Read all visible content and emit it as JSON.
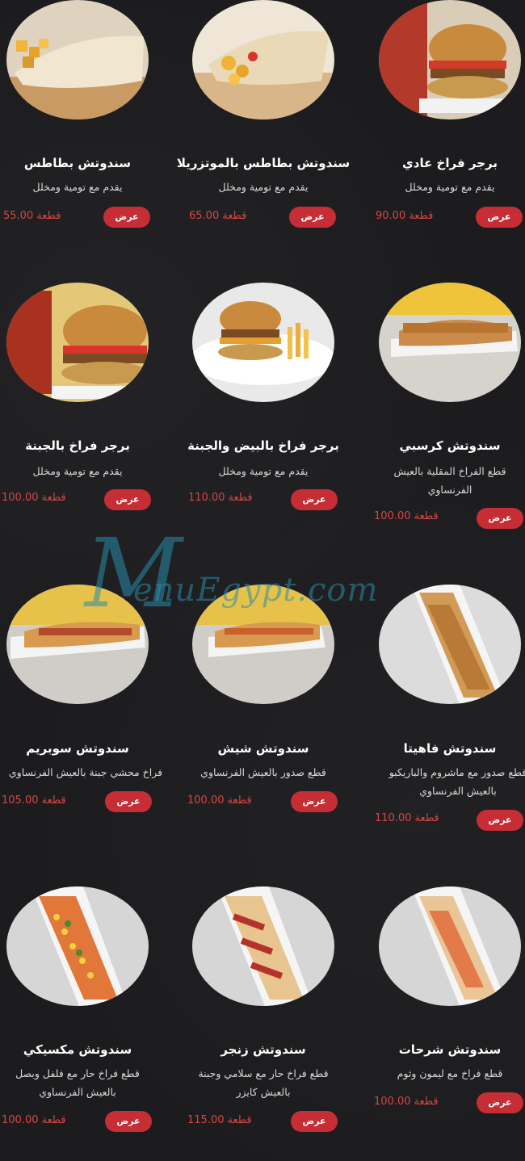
{
  "currency_unit": "قطعة",
  "button_label": "عرض",
  "watermark": {
    "initial": "M",
    "text": "enuEgypt.com"
  },
  "items": [
    {
      "name": "برجر فراخ عادي",
      "desc": [
        "يقدم مع تومية ومخلل"
      ],
      "price": "90.00",
      "image": "burger-photo"
    },
    {
      "name": "سندوتش بطاطس بالموتزريلا",
      "desc": [
        "يقدم مع تومية ومخلل"
      ],
      "price": "65.00",
      "image": "fries-wrap-photo"
    },
    {
      "name": "سندوتش بطاطس",
      "desc": [
        "يقدم مع تومية ومخلل"
      ],
      "price": "55.00",
      "image": "fries-wrap-photo"
    },
    {
      "name": "سندوتش كرسبي",
      "desc": [
        "قطع الفراخ المقلية بالعيش",
        "الفرنساوي"
      ],
      "price": "100.00",
      "image": "crispy-sandwich-photo"
    },
    {
      "name": "برجر فراخ بالبيض والجبنة",
      "desc": [
        "يقدم مع تومية ومخلل"
      ],
      "price": "110.00",
      "image": "burger-fries-photo"
    },
    {
      "name": "برجر فراخ بالجبنة",
      "desc": [
        "يقدم مع تومية ومخلل"
      ],
      "price": "100.00",
      "image": "burger-photo"
    },
    {
      "name": "سندوتش فاهيتا",
      "desc": [
        "قطع صدور مع ماشروم والباريكبو",
        "بالعيش الفرنساوي"
      ],
      "price": "110.00",
      "image": "fajita-sandwich-photo"
    },
    {
      "name": "سندوتش شيش",
      "desc": [
        "قطع صدور بالعيش الفرنساوي"
      ],
      "price": "100.00",
      "image": "hotdog-sandwich-photo"
    },
    {
      "name": "سندوتش سوبريم",
      "desc": [
        "فراخ محشي جبنة بالعيش الفرنساوي"
      ],
      "price": "105.00",
      "image": "hotdog-sandwich-photo"
    },
    {
      "name": "سندوتش شرحات",
      "desc": [
        "قطع فراخ مع ليمون وثوم"
      ],
      "price": "100.00",
      "image": "sub-sandwich-photo"
    },
    {
      "name": "سندوتش زنجر",
      "desc": [
        "قطع فراخ حار مع سلامي وجبنة",
        "بالعيش كايزر"
      ],
      "price": "115.00",
      "image": "sub-sandwich-photo"
    },
    {
      "name": "سندوتش مكسيكي",
      "desc": [
        "قطع فراخ حار مع فلفل وبصل",
        "بالعيش الفرنساوي"
      ],
      "price": "100.00",
      "image": "corn-sandwich-photo"
    }
  ]
}
